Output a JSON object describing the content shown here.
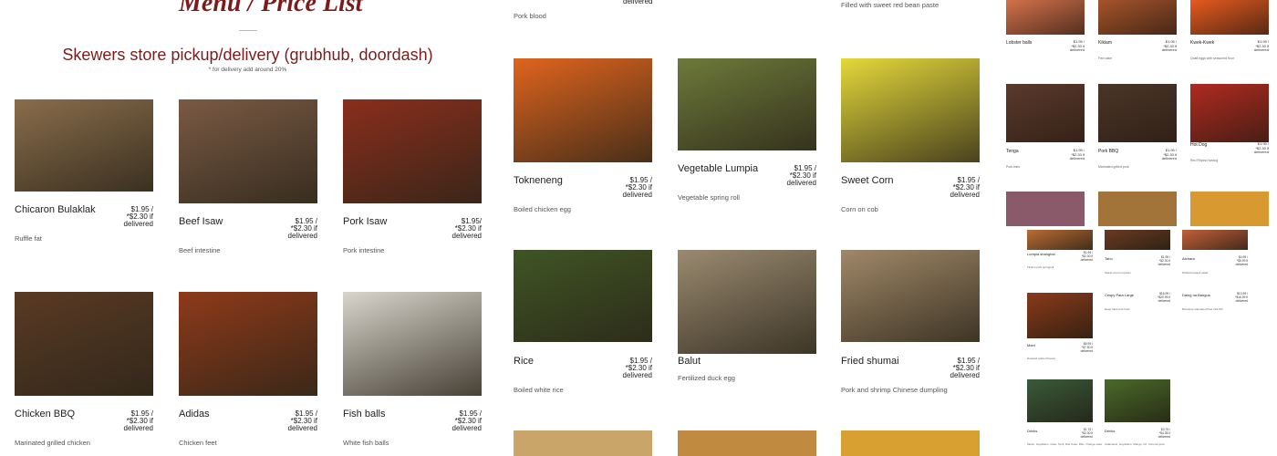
{
  "header": {
    "title": "Menu / Price List",
    "subtitle": "Skewers store pickup/delivery (grubhub, doordash)",
    "note": "* for delivery add around 20%"
  },
  "top_fragments": {
    "pork_blood": "Pork blood",
    "delivered_top": "delivered",
    "filled_sweet": "Filled with sweet red  bean paste"
  },
  "price_line1": "$1.95 /",
  "price_line2": "*$2.30 if",
  "price_line3": "delivered",
  "items": [
    {
      "name": "Chicaron Bulaklak",
      "desc": "Ruffle fat",
      "price": [
        "$1.95 /",
        "*$2.30 if",
        "delivered"
      ],
      "color": "#8a6d4b"
    },
    {
      "name": "Beef Isaw",
      "desc": "Beef intestine",
      "price": [
        "$1.95 /",
        "*$2.30 if",
        "delivered"
      ],
      "color": "#7a5a44"
    },
    {
      "name": "Pork Isaw",
      "desc": "Pork intestine",
      "price": [
        "$1.95/",
        "*$2.30 if",
        "delivered"
      ],
      "color": "#8a2e1c"
    },
    {
      "name": "Chicken BBQ",
      "desc": "Marinated grilled chicken",
      "price": [
        "$1.95 /",
        "*$2.30 if",
        "delivered"
      ],
      "color": "#5a3a24"
    },
    {
      "name": "Adidas",
      "desc": "Chicken feet",
      "price": [
        "$1.95 /",
        "*$2.30 if",
        "delivered"
      ],
      "color": "#8e3a1a"
    },
    {
      "name": "Fish balls",
      "desc": "White fish balls",
      "price": [
        "$1.95 /",
        "*$2.30 if",
        "delivered"
      ],
      "color": "#d9d5cc"
    },
    {
      "name": "Tokneneng",
      "desc": "Boiled chicken egg",
      "price": [
        "$1.95 /",
        "*$2.30 if",
        "delivered"
      ],
      "color": "#e0641e"
    },
    {
      "name": "Vegetable Lumpia",
      "desc": "Vegetable  spring roll",
      "price": [
        "$1.95 /",
        "*$2.30 if",
        "delivered"
      ],
      "color": "#6d7a3a"
    },
    {
      "name": "Sweet Corn",
      "desc": "Corn on cob",
      "price": [
        "$1.95 /",
        "*$2.30 if",
        "delivered"
      ],
      "color": "#e4d83a"
    },
    {
      "name": "Rice",
      "desc": "Boiled white rice",
      "price": [
        "$1.95 /",
        "*$2.30 if",
        "delivered"
      ],
      "color": "#3f5524"
    },
    {
      "name": "Balut",
      "desc": "Fertilized duck egg",
      "price": [
        "",
        "",
        ""
      ],
      "color": "#9a8a70"
    },
    {
      "name": "Fried shumai",
      "desc": "Pork and shrimp Chinese dumpling",
      "price": [
        "$1.95 /",
        "*$2.30 if",
        "delivered"
      ],
      "color": "#a08868"
    }
  ],
  "bottom_strip_colors": [
    "#c9a56a",
    "#c08a40",
    "#d8a030"
  ],
  "small_items": [
    {
      "name": "Lobster balls",
      "desc": "",
      "price": [
        "$1.95 /",
        "*$2.30 if",
        "delivered"
      ],
      "color": "#d4714a"
    },
    {
      "name": "Kikiam",
      "desc": "Fish cake",
      "price": [
        "$1.95 /",
        "*$2.30 if",
        "delivered"
      ],
      "color": "#a5542a"
    },
    {
      "name": "Kwek-Kwek",
      "desc": "Quail eggs with seasoned flour",
      "price": [
        "$1.95 /",
        "*$2.30 if",
        "delivered"
      ],
      "color": "#e65a1e"
    },
    {
      "name": "Tenga",
      "desc": "Pork ears",
      "price": [
        "$1.95 /",
        "*$2.30 if",
        "delivered"
      ],
      "color": "#5a3a2c"
    },
    {
      "name": "Pork BBQ",
      "desc": "Marinated  grilled pork",
      "price": [
        "$1.95 /",
        "*$2.30 if",
        "delivered"
      ],
      "color": "#4a3628"
    },
    {
      "name": "Hot Dog",
      "desc": "Red Filipino hotdog",
      "price": [
        "$1.95 /",
        "*$2.30 if",
        "delivered"
      ],
      "color": "#b02a20"
    }
  ],
  "small_row3_colors": [
    "#8a5a6a",
    "#a2743a",
    "#d89a30"
  ],
  "tiny_items": [
    {
      "name": "Lumpia shanghai",
      "desc": "Filipino pork springroll",
      "price": [
        "$1.95 /",
        "*$2.30 if",
        "delivered"
      ],
      "color": "#b86c34"
    },
    {
      "name": "Taho",
      "desc": "Sweet cured soybean",
      "price": [
        "$1.95 /",
        "*$2.30 if",
        "delivered"
      ],
      "color": "#6a3a22"
    },
    {
      "name": "Atchara",
      "desc": "Pickled papaya salad",
      "price": [
        "$4.99 /",
        "*$5.99 if",
        "delivered"
      ],
      "color": "#c2603a"
    },
    {
      "name": "Crispy Pata Large",
      "desc": "Deep fried pork hock",
      "price": [
        "$16.99 /",
        "*$20.99 if",
        "delivered"
      ],
      "color": "#7a4424"
    },
    {
      "name": "Daing na Bangus",
      "desc": "Boneless marinated fried milk fish",
      "price": [
        "$13.99 /",
        "*$16.99 if",
        "delivered"
      ],
      "color": "#9a6a3a"
    },
    {
      "name": "Mani",
      "desc": "Roasted Adobo Peanut",
      "price": [
        "$6.99 /",
        "*$7.50 if",
        "delivered"
      ],
      "color": "#8a3a1a"
    },
    {
      "name": "Drinks",
      "desc": "Melon, Guyabano, Coke, Sprit, Diet Coke, RGL, Orange soda",
      "price": [
        "$1.75 /",
        "*$2.30 if",
        "delivered"
      ],
      "color": "#3a5a3a"
    },
    {
      "name": "Drinks",
      "desc": "Calamansi, Guyabano, Mango, C2, Coconut juice",
      "price": [
        "$3.75 /",
        "*$4.35 if",
        "delivered"
      ],
      "color": "#4a6a2a"
    }
  ]
}
